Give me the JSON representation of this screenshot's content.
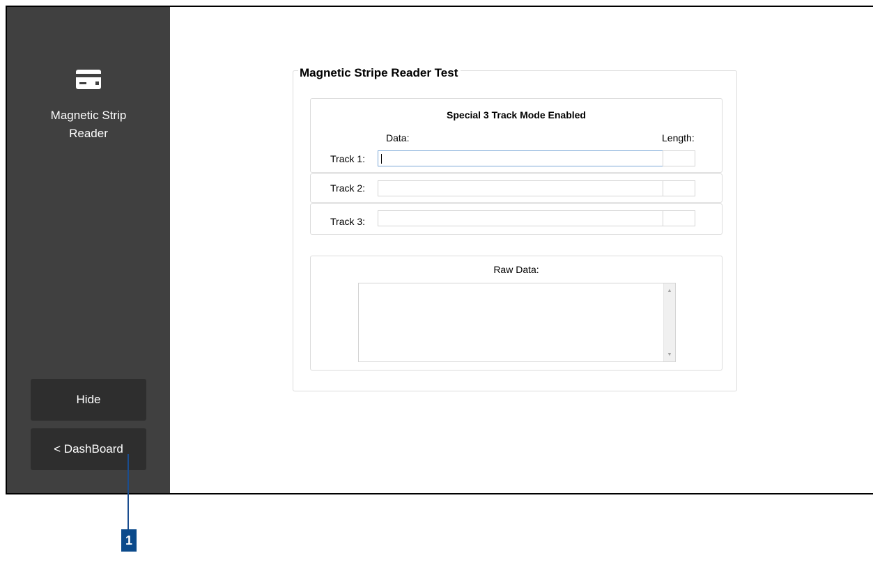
{
  "sidebar": {
    "icon": "card-icon",
    "title_line1": "Magnetic Strip",
    "title_line2": "Reader",
    "hide_button": "Hide",
    "dashboard_button": "< DashBoard"
  },
  "main": {
    "group_title": "Magnetic Stripe Reader Test",
    "mode_label": "Special 3 Track Mode Enabled",
    "data_header": "Data:",
    "length_header": "Length:",
    "tracks": [
      {
        "label": "Track 1:",
        "data": "",
        "length": ""
      },
      {
        "label": "Track 2:",
        "data": "",
        "length": ""
      },
      {
        "label": "Track 3:",
        "data": "",
        "length": ""
      }
    ],
    "raw_data_label": "Raw Data:",
    "raw_data_value": ""
  },
  "callout": {
    "number": "1"
  },
  "colors": {
    "sidebar_bg": "#404040",
    "sidebar_button_bg": "#2e2e2e",
    "callout_blue": "#0b4a8b"
  }
}
